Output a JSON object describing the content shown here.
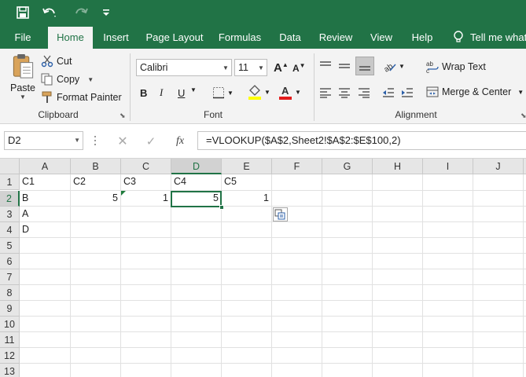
{
  "qat": {
    "save_icon": "save-icon",
    "undo_icon": "undo-icon",
    "redo_icon": "redo-icon",
    "customize_icon": "customize-qat-icon"
  },
  "tabs": [
    "File",
    "Home",
    "Insert",
    "Page Layout",
    "Formulas",
    "Data",
    "Review",
    "View",
    "Help"
  ],
  "tell_me": "Tell me what",
  "ribbon": {
    "clipboard": {
      "paste": "Paste",
      "cut": "Cut",
      "copy": "Copy",
      "format_painter": "Format Painter",
      "label": "Clipboard"
    },
    "font": {
      "name": "Calibri",
      "size": "11",
      "bold": "B",
      "italic": "I",
      "underline": "U",
      "label": "Font",
      "font_color": "#e31c1c",
      "highlight_color": "#ffff00"
    },
    "alignment": {
      "wrap_text": "Wrap Text",
      "merge_center": "Merge & Center",
      "label": "Alignment"
    }
  },
  "formula_bar": {
    "name_box": "D2",
    "fx": "fx",
    "formula": "=VLOOKUP($A$2,Sheet2!$A$2:$E$100,2)"
  },
  "columns": [
    "A",
    "B",
    "C",
    "D",
    "E",
    "F",
    "G",
    "H",
    "I",
    "J"
  ],
  "rows": [
    "1",
    "2",
    "3",
    "4",
    "5",
    "6",
    "7",
    "8",
    "9",
    "10",
    "11",
    "12",
    "13"
  ],
  "cells": {
    "A1": "C1",
    "B1": "C2",
    "C1": "C3",
    "D1": "C4",
    "E1": "C5",
    "A2": "B",
    "B2": "5",
    "C2": "1",
    "D2": "5",
    "E2": "1",
    "A3": "A",
    "A4": "D"
  },
  "colors": {
    "brand": "#217346",
    "ribbon_bg": "#f3f3f3"
  }
}
